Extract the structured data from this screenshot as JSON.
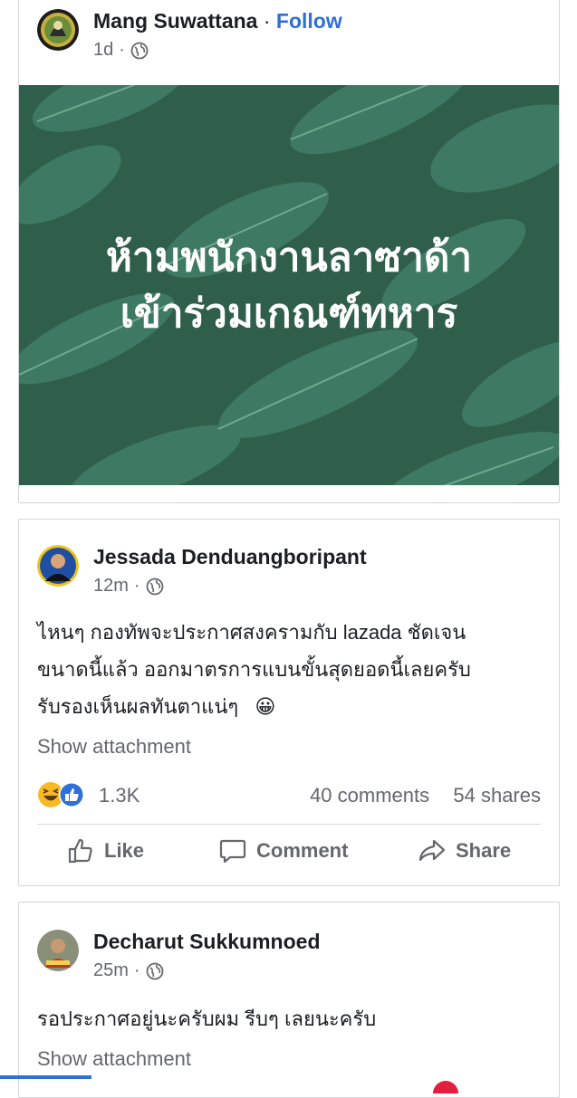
{
  "post1": {
    "author": "Mang Suwattana",
    "separator": "·",
    "follow_label": "Follow",
    "time": "1d",
    "meta_sep": "·",
    "privacy_icon": "globe-icon",
    "banner": {
      "line1": "ห้ามพนักงานลาซาด้า",
      "line2": "เข้าร่วมเกณฑ์ทหาร",
      "background": "#2f5f4b"
    }
  },
  "post2": {
    "author": "Jessada Denduangboripant",
    "time": "12m",
    "meta_sep": "·",
    "privacy_icon": "globe-icon",
    "text_lines": [
      "ไหนๆ กองทัพจะประกาศสงครามกับ lazada ชัดเจน",
      "ขนาดนี้แล้ว   ออกมาตรการแบนขั้นสุดยอดนี้เลยครับ",
      "รับรองเห็นผลทันตาแน่ๆ"
    ],
    "emoji": "😀",
    "show_attachment": "Show attachment",
    "reactions_icons": [
      "haha-icon",
      "like-icon"
    ],
    "reaction_count": "1.3K",
    "comments": "40 comments",
    "shares": "54 shares",
    "actions": {
      "like": "Like",
      "comment": "Comment",
      "share": "Share"
    }
  },
  "post3": {
    "author": "Decharut Sukkumnoed",
    "time": "25m",
    "meta_sep": "·",
    "privacy_icon": "globe-icon",
    "text": "รอประกาศอยู่นะครับผม รีบๆ เลยนะครับ",
    "show_attachment": "Show attachment"
  },
  "colors": {
    "accent": "#2e6fd8",
    "secondary_text": "#65676b",
    "border": "#d4d6da"
  }
}
